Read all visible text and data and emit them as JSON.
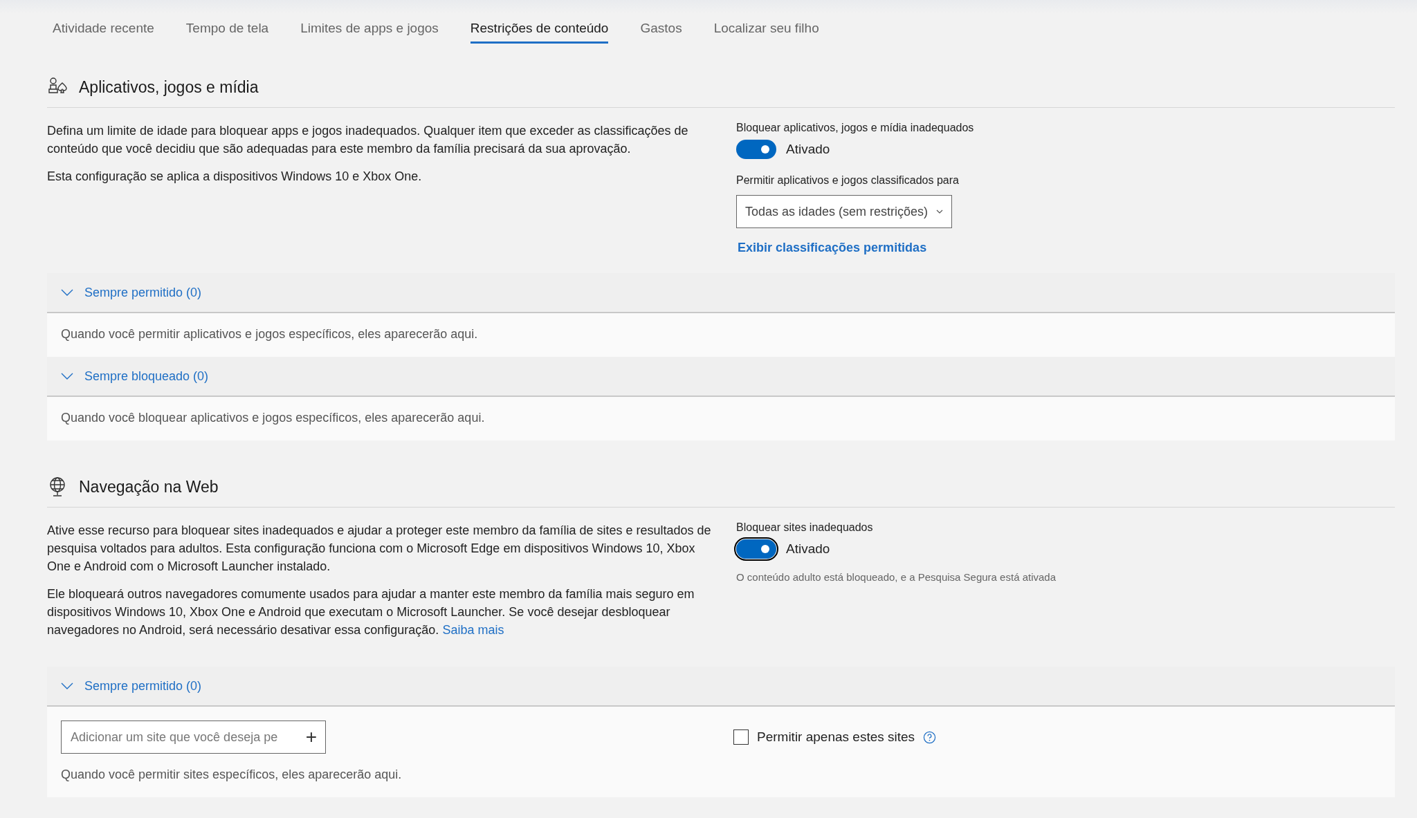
{
  "tabs": [
    {
      "label": "Atividade recente",
      "selected": false
    },
    {
      "label": "Tempo de tela",
      "selected": false
    },
    {
      "label": "Limites de apps e jogos",
      "selected": false
    },
    {
      "label": "Restrições de conteúdo",
      "selected": true
    },
    {
      "label": "Gastos",
      "selected": false
    },
    {
      "label": "Localizar seu filho",
      "selected": false
    }
  ],
  "sections": [
    {
      "kind": "apps",
      "title": "Aplicativos, jogos e mídia",
      "paragraphs": [
        {
          "text": "Defina um limite de idade para bloquear apps e jogos inadequados. Qualquer item que exceder as classificações de conteúdo que você decidiu que são adequadas para este membro da família precisará da sua aprovação."
        },
        {
          "text": "Esta configuração se aplica a dispositivos Windows 10 e Xbox One."
        }
      ],
      "toggle": {
        "label": "Bloquear aplicativos, jogos e mídia inadequados",
        "on": true,
        "focused": false,
        "state_text": "Ativado"
      },
      "age_select": {
        "label": "Permitir aplicativos e jogos classificados para",
        "value": "Todas as idades (sem restrições)"
      },
      "link": "Exibir classificações permitidas",
      "accordions": [
        {
          "title": "Sempre permitido (0)",
          "expanded": true,
          "empty_text": "Quando você permitir aplicativos e jogos específicos, eles aparecerão aqui."
        },
        {
          "title": "Sempre bloqueado (0)",
          "expanded": true,
          "empty_text": "Quando você bloquear aplicativos e jogos específicos, eles aparecerão aqui."
        }
      ]
    },
    {
      "kind": "web",
      "title": "Navegação na Web",
      "paragraphs": [
        {
          "text": "Ative esse recurso para bloquear sites inadequados e ajudar a proteger este membro da família de sites e resultados de pesquisa voltados para adultos. Esta configuração funciona com o Microsoft Edge em dispositivos Windows 10, Xbox One e Android com o Microsoft Launcher instalado."
        },
        {
          "text": "Ele bloqueará outros navegadores comumente usados para ajudar a manter este membro da família mais seguro em dispositivos Windows 10, Xbox One e Android que executam o Microsoft Launcher. Se você desejar desbloquear navegadores no Android, será necessário desativar essa configuração.",
          "link": "Saiba mais"
        }
      ],
      "toggle": {
        "label": "Bloquear sites inadequados",
        "on": true,
        "focused": true,
        "state_text": "Ativado"
      },
      "note": "O conteúdo adulto está bloqueado, e a Pesquisa Segura está ativada",
      "accordions": [
        {
          "title": "Sempre permitido (0)",
          "expanded": true,
          "empty_text": "Quando você permitir sites específicos, eles aparecerão aqui.",
          "add_field": {
            "placeholder": "Adicionar um site que você deseja pe",
            "button": "+"
          },
          "checkbox": {
            "label": "Permitir apenas estes sites",
            "checked": false
          }
        }
      ]
    }
  ]
}
